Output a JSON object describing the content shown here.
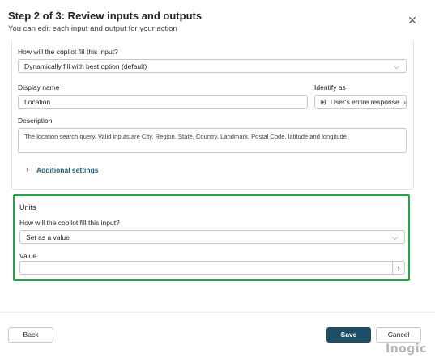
{
  "header": {
    "title": "Step 2 of 3: Review inputs and outputs",
    "subtitle": "You can edit each input and output for your action",
    "close_icon": "close-icon"
  },
  "location_input": {
    "fill_label": "How will the copilot fill this input?",
    "fill_value": "Dynamically fill with best option (default)",
    "display_name_label": "Display name",
    "display_name_value": "Location",
    "identify_label": "Identify as",
    "identify_value": "User's entire response",
    "identify_icon": "grid-icon",
    "description_label": "Description",
    "description_value": "The location search query. Valid inputs are City, Region, State, Country, Landmark, Postal Code, latitude and longitude",
    "additional_settings": "Additional settings"
  },
  "units_input": {
    "title": "Units",
    "fill_label": "How will the copilot fill this input?",
    "fill_value": "Set as a value",
    "value_label": "Value",
    "value_value": ""
  },
  "footer": {
    "back_label": "Back",
    "save_label": "Save",
    "cancel_label": "Cancel"
  },
  "watermark": "Inogic",
  "colors": {
    "accent": "#1d4e64",
    "highlight_border": "#22a547",
    "link": "#1a5d75"
  }
}
